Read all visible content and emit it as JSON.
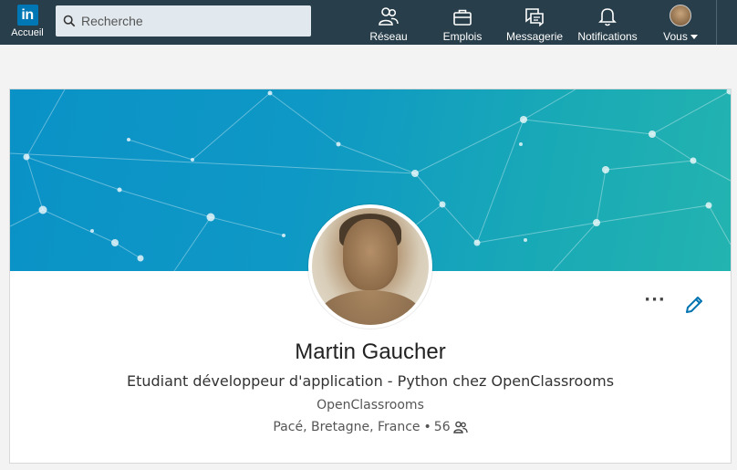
{
  "nav": {
    "home_label": "Accueil",
    "logo_text": "in",
    "search_placeholder": "Recherche",
    "items": [
      {
        "label": "Réseau",
        "icon": "people-icon"
      },
      {
        "label": "Emplois",
        "icon": "briefcase-icon"
      },
      {
        "label": "Messagerie",
        "icon": "messaging-icon"
      },
      {
        "label": "Notifications",
        "icon": "bell-icon"
      },
      {
        "label": "Vous",
        "icon": "avatar"
      }
    ]
  },
  "profile": {
    "name": "Martin Gaucher",
    "headline": "Etudiant développeur d'application - Python chez OpenClassrooms",
    "company": "OpenClassrooms",
    "location": "Pacé, Bretagne, France",
    "separator": "•",
    "connections": "56",
    "more_label": "···"
  },
  "colors": {
    "nav_bg": "#283e4a",
    "brand": "#0077b5",
    "banner_start": "#0a92c7",
    "banner_end": "#23b3b0",
    "edit_icon": "#0073b1"
  }
}
